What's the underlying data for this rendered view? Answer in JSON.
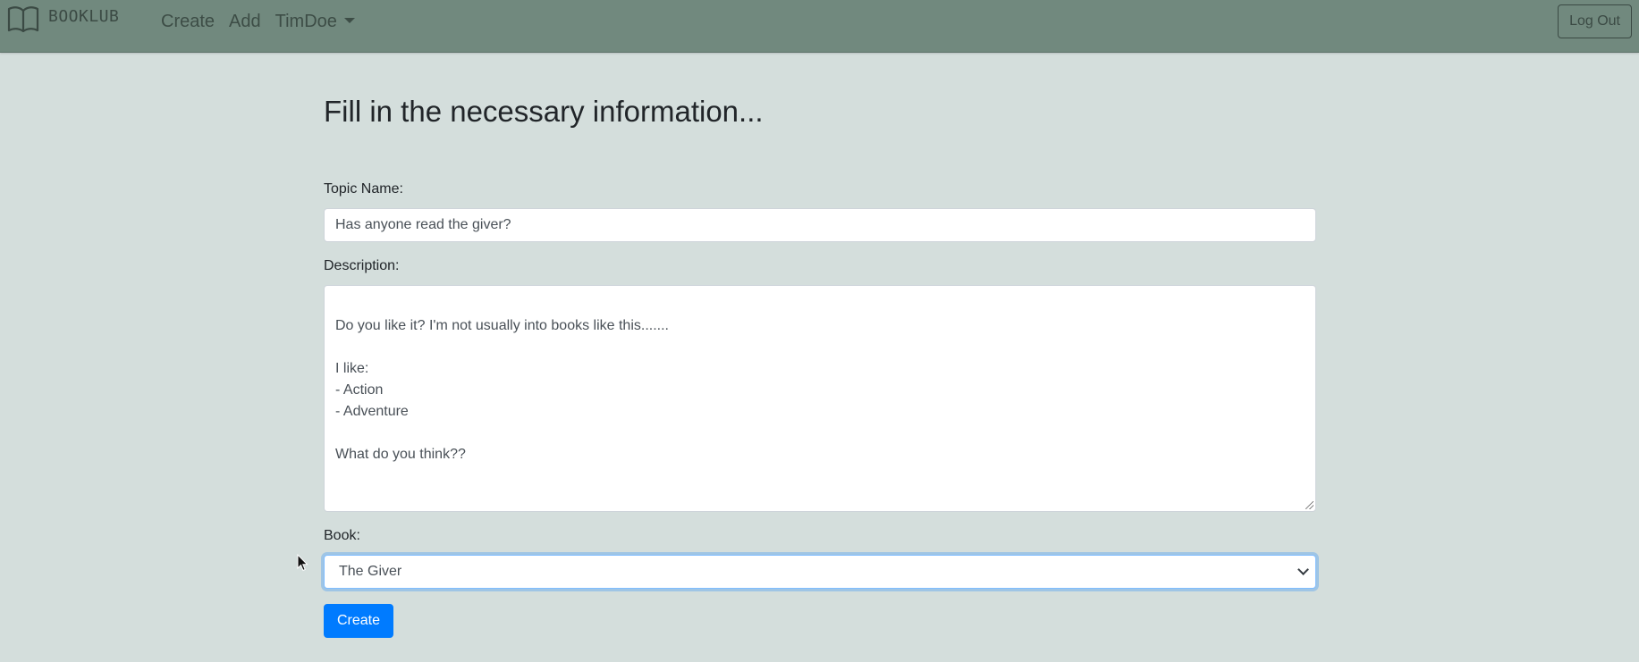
{
  "navbar": {
    "brand": "BOOKLUB",
    "brand_icon": "open-book-icon",
    "links": [
      "Create",
      "Add",
      "TimDoe"
    ],
    "logout_label": "Log Out",
    "background": "#71897e"
  },
  "form": {
    "title": "Fill in the necessary information...",
    "topic_label": "Topic Name:",
    "topic_value": "Has anyone read the giver?",
    "description_label": "Description:",
    "description_value": "Do you like it? I'm not usually into books like this.......\n\nI like:\n- Action\n- Adventure\n\nWhat do you think??",
    "book_label": "Book:",
    "book_selected": "The Giver",
    "submit_label": "Create"
  },
  "colors": {
    "page_background": "#d4dedc",
    "primary_button": "#007bff",
    "focus_border": "#80bdff"
  }
}
